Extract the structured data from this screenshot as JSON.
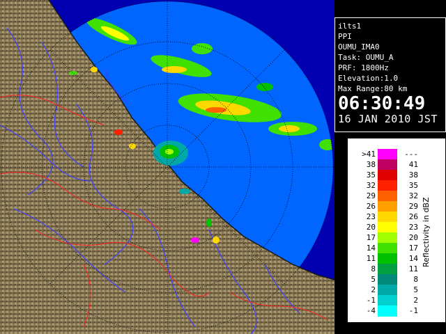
{
  "info": {
    "site": "ilts1",
    "product": "PPI",
    "volume": "OUMU_IMA0",
    "task": "Task: OUMU_A",
    "prf": "PRF: 1800Hz",
    "elevation": "Elevation:1.0",
    "max_range": "Max Range:80 km",
    "time": "06:30:49",
    "date": "16 JAN 2010 JST"
  },
  "legend": {
    "unit": "Reflectivity in dBZ",
    "rows": [
      {
        "lo": ">41",
        "hi": "---",
        "color": "#ff00ff"
      },
      {
        "lo": "38",
        "hi": "41",
        "color": "#c00060"
      },
      {
        "lo": "35",
        "hi": "38",
        "color": "#e00000"
      },
      {
        "lo": "32",
        "hi": "35",
        "color": "#ff2000"
      },
      {
        "lo": "29",
        "hi": "32",
        "color": "#ff6000"
      },
      {
        "lo": "26",
        "hi": "29",
        "color": "#ffa000"
      },
      {
        "lo": "23",
        "hi": "26",
        "color": "#ffd800"
      },
      {
        "lo": "20",
        "hi": "23",
        "color": "#ffff00"
      },
      {
        "lo": "17",
        "hi": "20",
        "color": "#a0ff00"
      },
      {
        "lo": "14",
        "hi": "17",
        "color": "#40e000"
      },
      {
        "lo": "11",
        "hi": "14",
        "color": "#00c000"
      },
      {
        "lo": "8",
        "hi": "11",
        "color": "#00a040"
      },
      {
        "lo": "5",
        "hi": "8",
        "color": "#008878"
      },
      {
        "lo": "2",
        "hi": "5",
        "color": "#00a8a8"
      },
      {
        "lo": "-1",
        "hi": "2",
        "color": "#00d0d0"
      },
      {
        "lo": "-4",
        "hi": "-1",
        "color": "#00ffff"
      }
    ]
  },
  "colors": {
    "sea": "#0066ff",
    "outside_range": "#0000b0",
    "land": "#8a7a56",
    "rings": "#000000",
    "rivers": "#4040ff",
    "boundaries": "#ff2020"
  }
}
